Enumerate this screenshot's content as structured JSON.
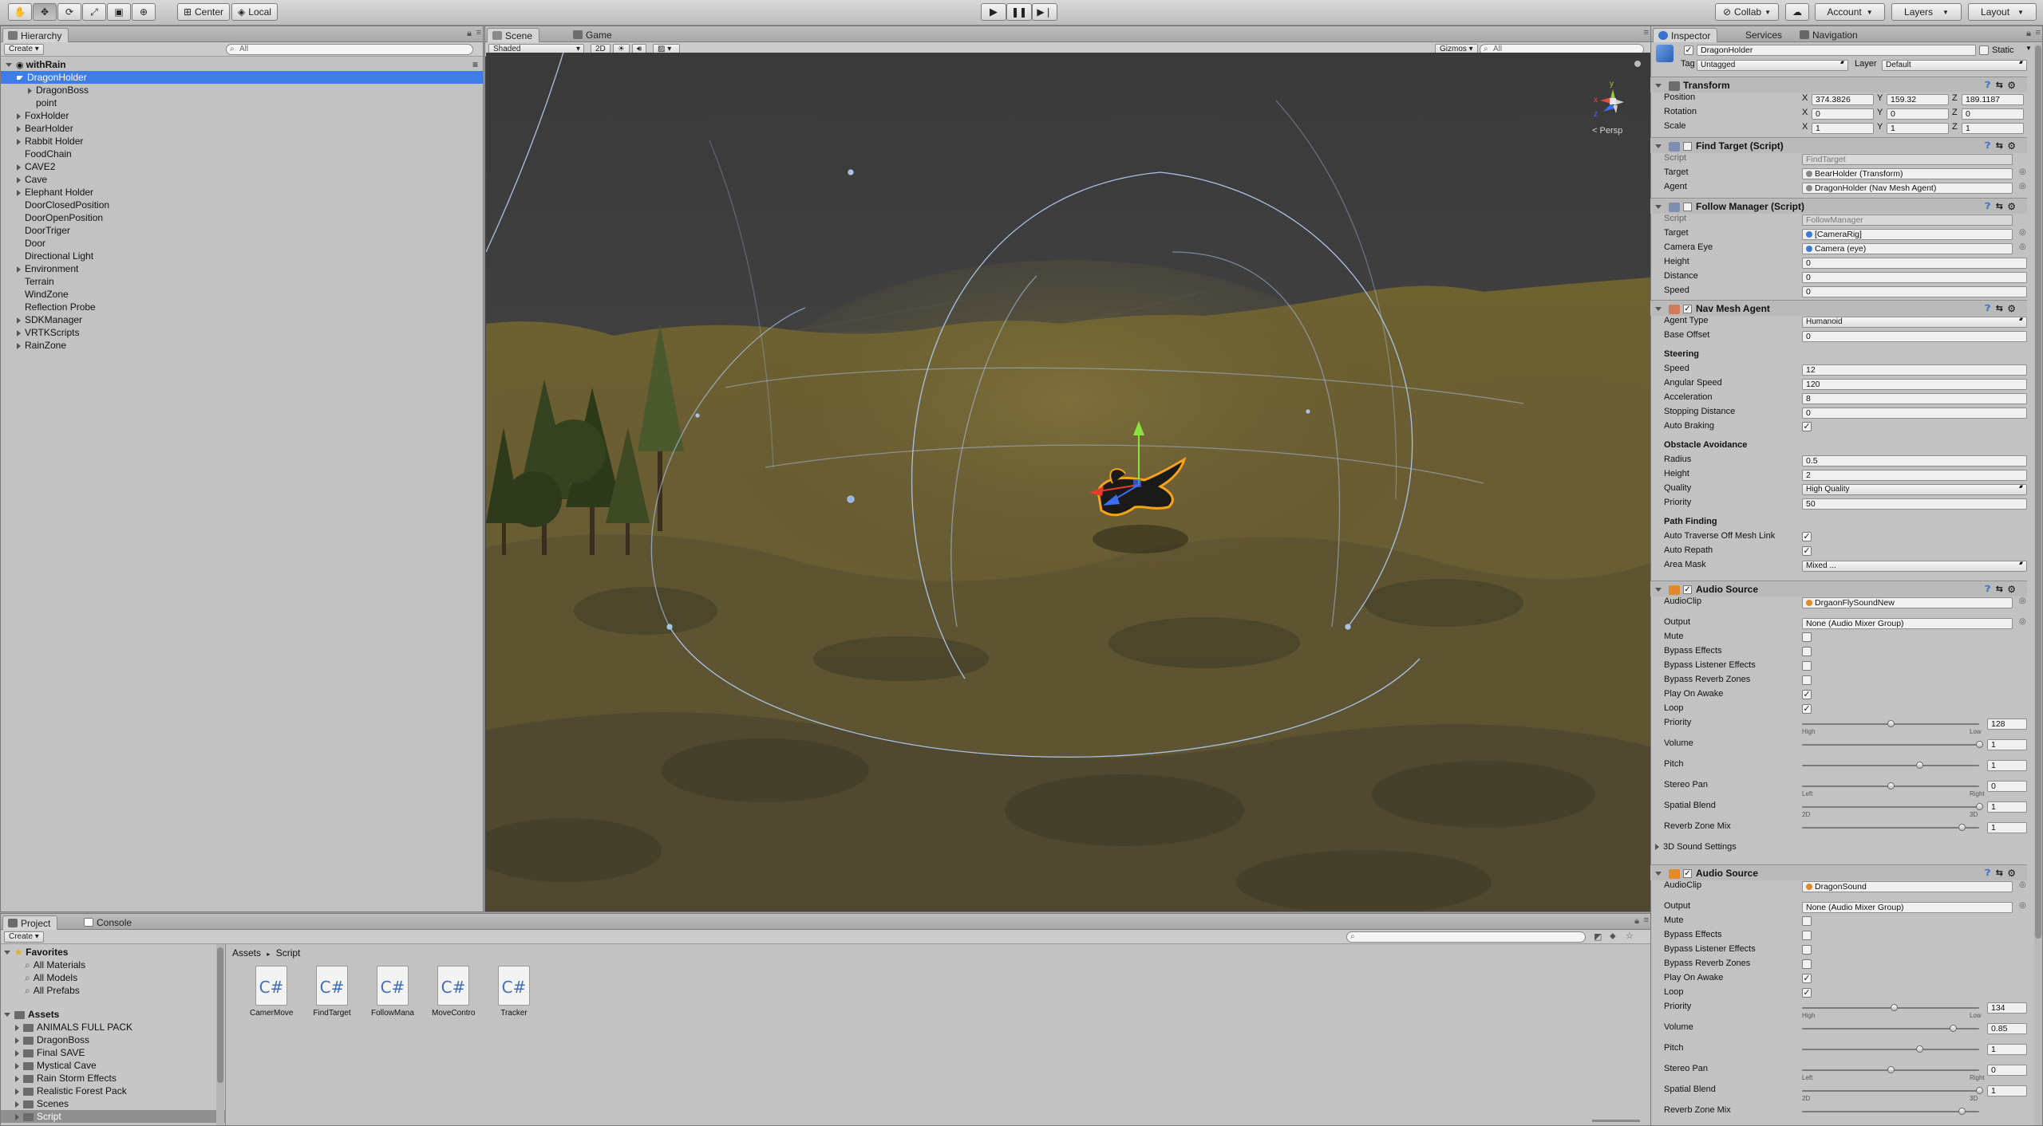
{
  "toolbar": {
    "pivot": "Center",
    "space": "Local",
    "collab": "Collab",
    "account": "Account",
    "layers": "Layers",
    "layout": "Layout"
  },
  "hierarchy": {
    "tab": "Hierarchy",
    "create": "Create",
    "search_placeholder": "All",
    "scene_name": "withRain",
    "items": [
      {
        "label": "DragonHolder",
        "indent": 1,
        "expand": "down",
        "selected": true
      },
      {
        "label": "DragonBoss",
        "indent": 2,
        "expand": "right"
      },
      {
        "label": "point",
        "indent": 2,
        "expand": ""
      },
      {
        "label": "FoxHolder",
        "indent": 1,
        "expand": "right"
      },
      {
        "label": "BearHolder",
        "indent": 1,
        "expand": "right"
      },
      {
        "label": "Rabbit Holder",
        "indent": 1,
        "expand": "right"
      },
      {
        "label": "FoodChain",
        "indent": 1,
        "expand": ""
      },
      {
        "label": "CAVE2",
        "indent": 1,
        "expand": "right"
      },
      {
        "label": "Cave",
        "indent": 1,
        "expand": "right"
      },
      {
        "label": "Elephant Holder",
        "indent": 1,
        "expand": "right"
      },
      {
        "label": "DoorClosedPosition",
        "indent": 1,
        "expand": ""
      },
      {
        "label": "DoorOpenPosition",
        "indent": 1,
        "expand": ""
      },
      {
        "label": "DoorTriger",
        "indent": 1,
        "expand": ""
      },
      {
        "label": "Door",
        "indent": 1,
        "expand": ""
      },
      {
        "label": "Directional Light",
        "indent": 1,
        "expand": ""
      },
      {
        "label": "Environment",
        "indent": 1,
        "expand": "right"
      },
      {
        "label": "Terrain",
        "indent": 1,
        "expand": ""
      },
      {
        "label": "WindZone",
        "indent": 1,
        "expand": ""
      },
      {
        "label": "Reflection Probe",
        "indent": 1,
        "expand": ""
      },
      {
        "label": "SDKManager",
        "indent": 1,
        "expand": "right"
      },
      {
        "label": "VRTKScripts",
        "indent": 1,
        "expand": "right"
      },
      {
        "label": "RainZone",
        "indent": 1,
        "expand": "right"
      }
    ]
  },
  "scene": {
    "tab_scene": "Scene",
    "tab_game": "Game",
    "shading": "Shaded",
    "mode2d": "2D",
    "gizmos": "Gizmos",
    "search_placeholder": "All",
    "persp": "Persp"
  },
  "project": {
    "tab_project": "Project",
    "tab_console": "Console",
    "create": "Create",
    "breadcrumb": [
      "Assets",
      "Script"
    ],
    "favorites_label": "Favorites",
    "favorites": [
      "All Materials",
      "All Models",
      "All Prefabs"
    ],
    "assets_label": "Assets",
    "folders": [
      "ANIMALS FULL PACK",
      "DragonBoss",
      "Final SAVE",
      "Mystical Cave",
      "Rain Storm Effects",
      "Realistic Forest Pack",
      "Scenes",
      "Script"
    ],
    "selected_folder": "Script",
    "files": [
      "CamerMove...",
      "FindTarget",
      "FollowManag...",
      "MoveControll...",
      "Tracker"
    ],
    "file_icon": "C#"
  },
  "inspector": {
    "tabs": [
      "Inspector",
      "Services",
      "Navigation"
    ],
    "object_name": "DragonHolder",
    "static_label": "Static",
    "tag_label": "Tag",
    "tag_value": "Untagged",
    "layer_label": "Layer",
    "layer_value": "Default",
    "transform": {
      "title": "Transform",
      "position": [
        "374.3826",
        "159.32",
        "189.1187"
      ],
      "rotation": [
        "0",
        "0",
        "0"
      ],
      "scale": [
        "1",
        "1",
        "1"
      ],
      "labels": [
        "Position",
        "Rotation",
        "Scale"
      ],
      "axes": [
        "X",
        "Y",
        "Z"
      ]
    },
    "find_target": {
      "title": "Find Target (Script)",
      "script_label": "Script",
      "script": "FindTarget",
      "target_label": "Target",
      "target": "BearHolder (Transform)",
      "agent_label": "Agent",
      "agent": "DragonHolder (Nav Mesh Agent)"
    },
    "follow_manager": {
      "title": "Follow Manager (Script)",
      "script_label": "Script",
      "script": "FollowManager",
      "target_label": "Target",
      "target": "[CameraRig]",
      "camera_eye_label": "Camera Eye",
      "camera_eye": "Camera (eye)",
      "height_label": "Height",
      "height": "0",
      "distance_label": "Distance",
      "distance": "0",
      "speed_label": "Speed",
      "speed": "0"
    },
    "nav_mesh": {
      "title": "Nav Mesh Agent",
      "agent_type_label": "Agent Type",
      "agent_type": "Humanoid",
      "base_offset_label": "Base Offset",
      "base_offset": "0",
      "steering_label": "Steering",
      "speed_label": "Speed",
      "speed": "12",
      "angular_speed_label": "Angular Speed",
      "angular_speed": "120",
      "acceleration_label": "Acceleration",
      "acceleration": "8",
      "stopping_distance_label": "Stopping Distance",
      "stopping_distance": "0",
      "auto_braking_label": "Auto Braking",
      "obstacle_label": "Obstacle Avoidance",
      "radius_label": "Radius",
      "radius": "0.5",
      "height_label": "Height",
      "height": "2",
      "quality_label": "Quality",
      "quality": "High Quality",
      "priority_label": "Priority",
      "priority": "50",
      "path_label": "Path Finding",
      "auto_traverse_label": "Auto Traverse Off Mesh Link",
      "auto_repath_label": "Auto Repath",
      "area_mask_label": "Area Mask",
      "area_mask": "Mixed ..."
    },
    "audio1": {
      "title": "Audio Source",
      "clip_label": "AudioClip",
      "clip": "DrgaonFlySoundNew",
      "output_label": "Output",
      "output": "None (Audio Mixer Group)",
      "mute": "Mute",
      "bypass_effects": "Bypass Effects",
      "bypass_listener": "Bypass Listener Effects",
      "bypass_reverb": "Bypass Reverb Zones",
      "play_on_awake": "Play On Awake",
      "loop": "Loop",
      "priority_label": "Priority",
      "priority": "128",
      "priority_pos": 0.5,
      "high": "High",
      "low": "Low",
      "volume_label": "Volume",
      "volume": "1",
      "volume_pos": 1.0,
      "pitch_label": "Pitch",
      "pitch": "1",
      "pitch_pos": 0.66,
      "pan_label": "Stereo Pan",
      "pan": "0",
      "pan_pos": 0.5,
      "left": "Left",
      "right": "Right",
      "spatial_label": "Spatial Blend",
      "spatial": "1",
      "spatial_pos": 1.0,
      "d2": "2D",
      "d3": "3D",
      "reverb_label": "Reverb Zone Mix",
      "reverb": "1",
      "reverb_pos": 0.9,
      "sound3d_label": "3D Sound Settings"
    },
    "audio2": {
      "title": "Audio Source",
      "clip_label": "AudioClip",
      "clip": "DragonSound",
      "output_label": "Output",
      "output": "None (Audio Mixer Group)",
      "mute": "Mute",
      "bypass_effects": "Bypass Effects",
      "bypass_listener": "Bypass Listener Effects",
      "bypass_reverb": "Bypass Reverb Zones",
      "play_on_awake": "Play On Awake",
      "loop": "Loop",
      "priority_label": "Priority",
      "priority": "134",
      "priority_pos": 0.52,
      "high": "High",
      "low": "Low",
      "volume_label": "Volume",
      "volume": "0.85",
      "volume_pos": 0.85,
      "pitch_label": "Pitch",
      "pitch": "1",
      "pitch_pos": 0.66,
      "pan_label": "Stereo Pan",
      "pan": "0",
      "pan_pos": 0.5,
      "left": "Left",
      "right": "Right",
      "spatial_label": "Spatial Blend",
      "spatial": "1",
      "spatial_pos": 1.0,
      "d2": "2D",
      "d3": "3D",
      "reverb_label": "Reverb Zone Mix"
    }
  },
  "colors": {
    "selection": "#3e7de7",
    "panel": "#c2c2c2",
    "accent_orange": "#f7a21b"
  }
}
